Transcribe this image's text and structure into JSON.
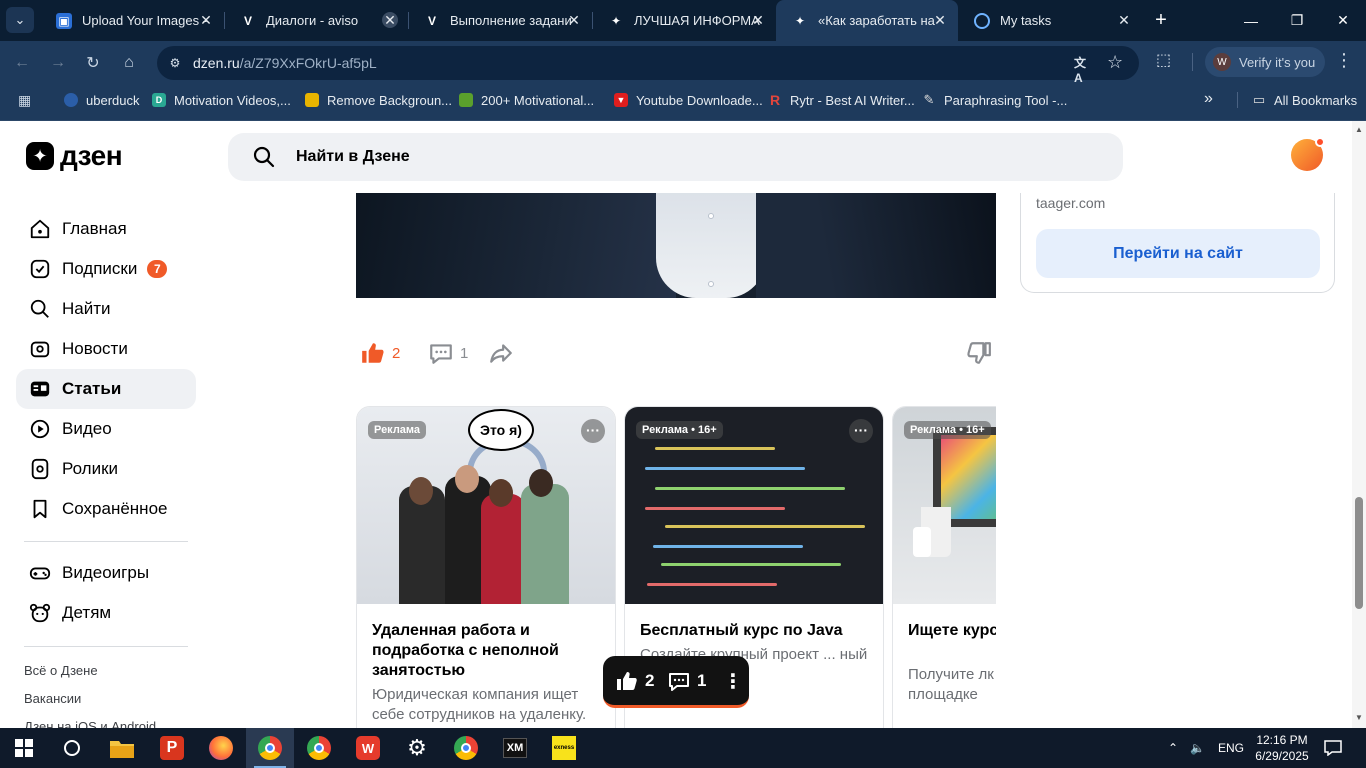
{
  "browser": {
    "tabs": [
      {
        "title": "Upload Your Images -",
        "icon": "image-icon",
        "active": false
      },
      {
        "title": "Диалоги - aviso",
        "icon": "aviso-icon",
        "active": false
      },
      {
        "title": "Выполнение задани",
        "icon": "aviso-icon",
        "active": false
      },
      {
        "title": "ЛУЧШАЯ ИНФОРМА",
        "icon": "dzen-icon",
        "active": false
      },
      {
        "title": "«Как заработать на",
        "icon": "dzen-icon",
        "active": true
      },
      {
        "title": "My tasks",
        "icon": "tasks-icon",
        "active": false
      }
    ],
    "url_host": "dzen.ru",
    "url_path": "/a/Z79XxFOkrU-af5pL",
    "profile_label": "Verify it's you",
    "profile_initial": "W",
    "bookmarks": [
      {
        "label": "uberduck",
        "color": "#2b5ea8"
      },
      {
        "label": "Motivation Videos,...",
        "color": "#2aa893"
      },
      {
        "label": "Remove Backgroun...",
        "color": "#e8b400"
      },
      {
        "label": "200+ Motivational...",
        "color": "#5aa02c"
      },
      {
        "label": "Youtube Downloade...",
        "color": "#e01e1e"
      },
      {
        "label": "Rytr - Best AI Writer...",
        "color": "#e2453c"
      },
      {
        "label": "Paraphrasing Tool -...",
        "color": "#bbbbbb"
      }
    ],
    "all_bookmarks": "All Bookmarks"
  },
  "dzen": {
    "logo_text": "дзен",
    "search_placeholder": "Найти в Дзене",
    "nav": [
      {
        "label": "Главная",
        "icon": "home-icon"
      },
      {
        "label": "Подписки",
        "icon": "subscriptions-icon",
        "badge": "7"
      },
      {
        "label": "Найти",
        "icon": "search-icon"
      },
      {
        "label": "Новости",
        "icon": "news-icon"
      },
      {
        "label": "Статьи",
        "icon": "articles-icon",
        "active": true
      },
      {
        "label": "Видео",
        "icon": "video-icon"
      },
      {
        "label": "Ролики",
        "icon": "shorts-icon"
      },
      {
        "label": "Сохранённое",
        "icon": "bookmark-icon"
      }
    ],
    "nav2": [
      {
        "label": "Видеоигры",
        "icon": "gamepad-icon"
      },
      {
        "label": "Детям",
        "icon": "kids-icon"
      }
    ],
    "footer_links": [
      "Всё о Дзене",
      "Вакансии",
      "Дзен на iOS и Android"
    ],
    "likes": "2",
    "comments": "1",
    "cards": [
      {
        "tag": "Реклама",
        "title": "Удаленная работа и подработка с неполной занятостью",
        "desc": "Юридическая компания ищет себе сотрудников на удаленку.",
        "speech": "Это я)"
      },
      {
        "tag": "Реклама • 16+",
        "title": "Бесплатный курс по Java",
        "desc": "Создайте крупный проект ... ный курс."
      },
      {
        "tag": "Реклама • 16+",
        "title": "Ищете курсы бесплатно?",
        "desc": "Получите лк бесплатно п на площадке"
      }
    ],
    "ad_side": {
      "domain": "taager.com",
      "button": "Перейти на сайт"
    },
    "floating": {
      "likes": "2",
      "comments": "1"
    }
  },
  "taskbar": {
    "lang": "ENG",
    "time": "12:16 PM",
    "date": "6/29/2025",
    "apps": [
      "windows-start",
      "search",
      "file-explorer",
      "wps-presentation",
      "firefox",
      "chrome-profile",
      "chrome",
      "wps-office",
      "settings",
      "chrome-alt",
      "xm",
      "exness"
    ]
  },
  "colors": {
    "accent": "#f05a28",
    "link_blue": "#1a5fd0",
    "chrome_dark": "#0b1e33",
    "chrome_mid": "#1e3a5c"
  }
}
